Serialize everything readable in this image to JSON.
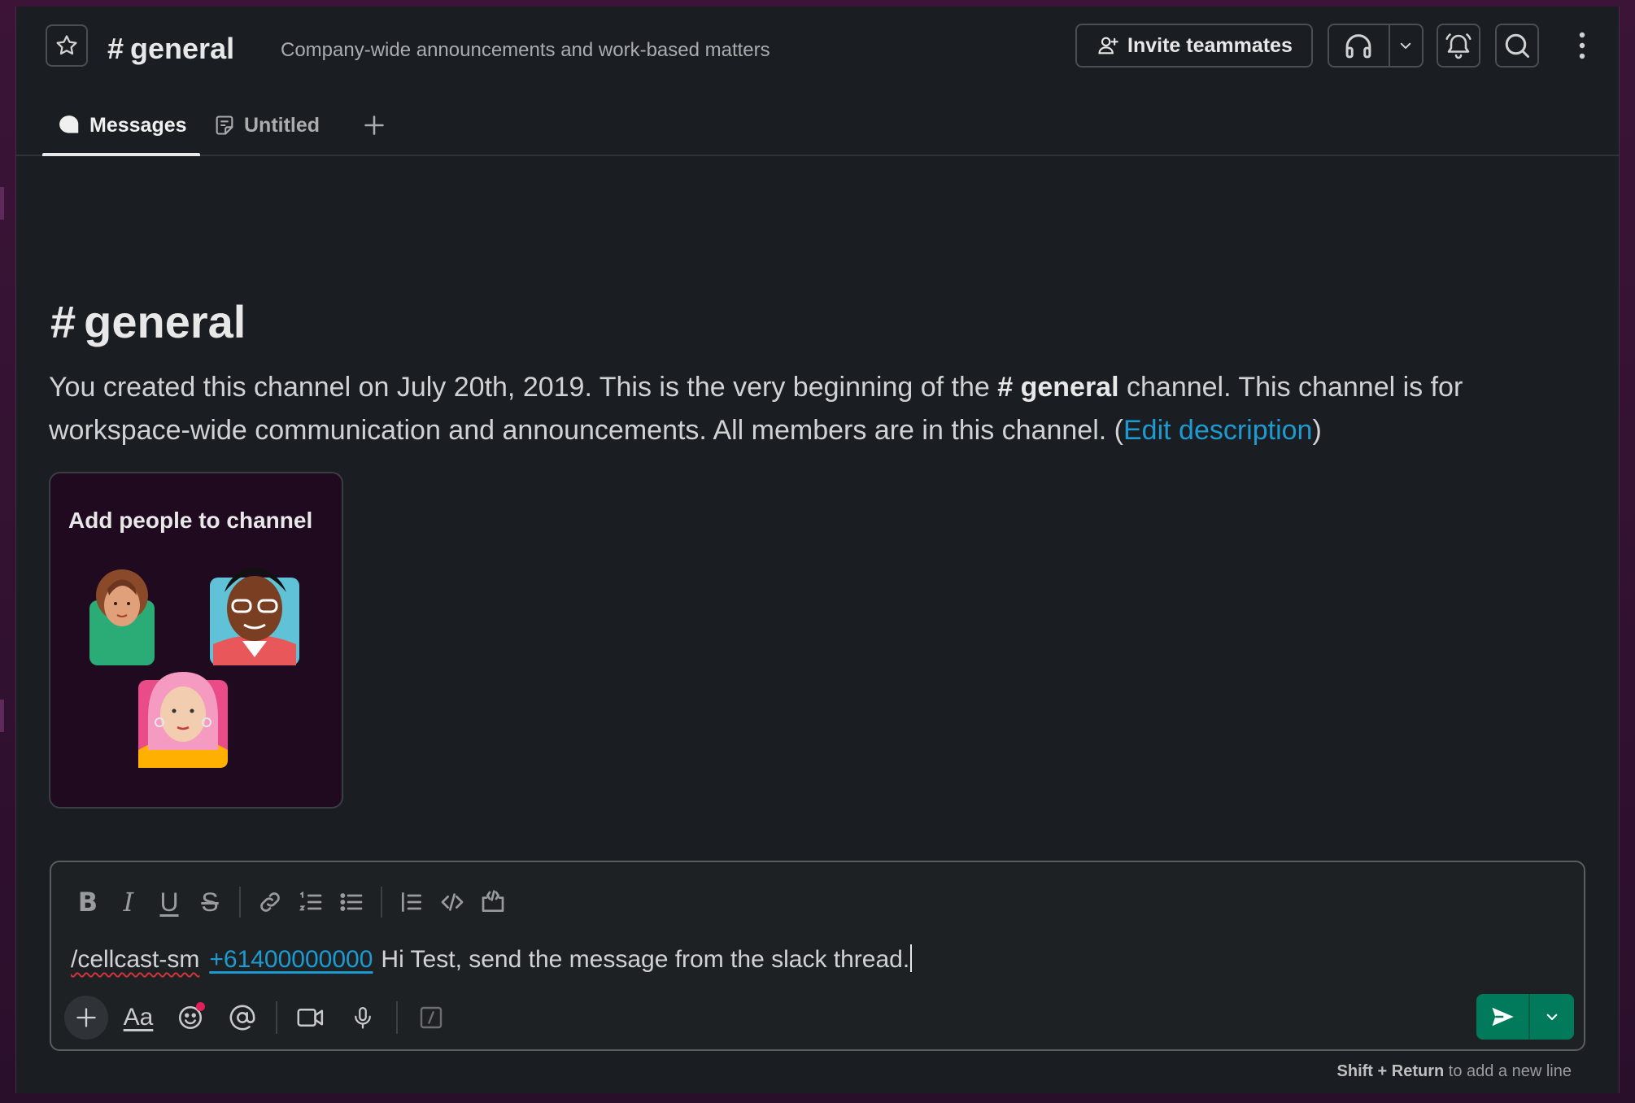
{
  "colors": {
    "background": "#1a1d21",
    "accent_link": "#1d9bd1",
    "send_button": "#007a5a",
    "card_background": "#1f0a1f"
  },
  "header": {
    "channel_hash": "#",
    "channel_name": "general",
    "topic": "Company-wide announcements and work-based matters",
    "invite_label": "Invite teammates",
    "icons": [
      "star-icon",
      "user-plus-icon",
      "headphones-icon",
      "chevron-down-icon",
      "bell-icon",
      "search-icon",
      "more-vertical-icon"
    ]
  },
  "tabs": [
    {
      "label": "Messages",
      "icon": "message-bubble-icon",
      "active": true
    },
    {
      "label": "Untitled",
      "icon": "canvas-icon",
      "active": false
    }
  ],
  "intro": {
    "hash": "#",
    "title": "general",
    "text_part1": "You created this channel on July 20th, 2019. This is the very beginning of the",
    "text_channel": "# general",
    "text_part2": "channel. This channel is for workspace-wide communication and announcements. All members are in this channel. (",
    "edit_link": "Edit description",
    "text_end": ")"
  },
  "add_people_card": {
    "title": "Add people to channel"
  },
  "composer": {
    "formatting_icons": [
      "bold-icon",
      "italic-icon",
      "underline-icon",
      "strikethrough-icon",
      "link-icon",
      "ordered-list-icon",
      "bulleted-list-icon",
      "blockquote-icon",
      "code-icon",
      "code-block-icon"
    ],
    "command": "/cellcast-sms",
    "command_visible": "/cellcast-sm",
    "phone": "+61400000000",
    "message": "Hi Test,  send the message from the slack thread.",
    "bottom_icons": [
      "plus-icon",
      "formatting-aa-icon",
      "emoji-icon",
      "mention-icon",
      "video-icon",
      "microphone-icon",
      "slash-command-icon"
    ],
    "aa_label": "Aa"
  },
  "hint": {
    "keys": "Shift + Return",
    "text": "to add a new line"
  }
}
